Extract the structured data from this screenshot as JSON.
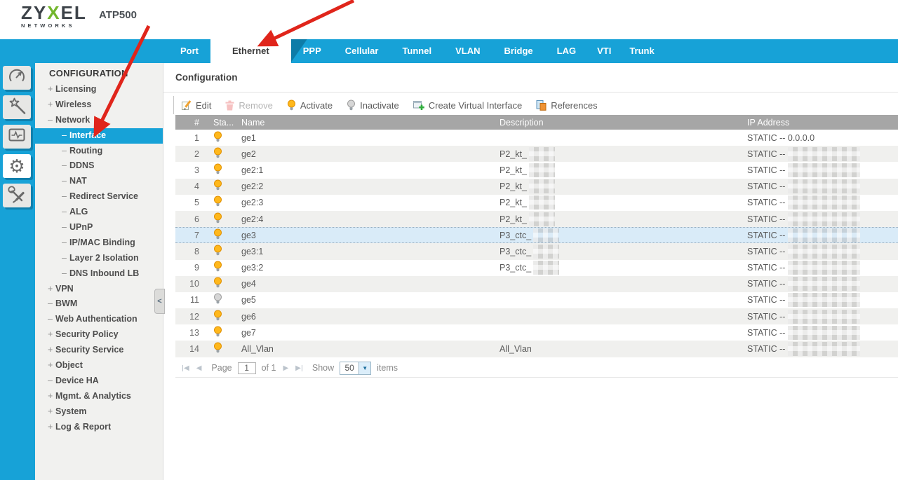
{
  "brand": {
    "logo_word": "ZYXEL",
    "logo_sub": "NETWORKS",
    "model": "ATP500"
  },
  "colors": {
    "accent_blue": "#17a2d7",
    "accent_dark_blue": "#0d7ca8",
    "bulb_on": "#ffb81c",
    "bulb_off": "#d6d6d6",
    "arrow_red": "#e0251b",
    "selected_row": "#d9ebf8",
    "table_header": "#a6a6a6"
  },
  "tabs": [
    {
      "label": "Port",
      "active": false
    },
    {
      "label": "Ethernet",
      "active": true
    },
    {
      "label": "PPP",
      "active": false
    },
    {
      "label": "Cellular",
      "active": false
    },
    {
      "label": "Tunnel",
      "active": false
    },
    {
      "label": "VLAN",
      "active": false
    },
    {
      "label": "Bridge",
      "active": false
    },
    {
      "label": "LAG",
      "active": false
    },
    {
      "label": "VTI",
      "active": false,
      "narrow": true
    },
    {
      "label": "Trunk",
      "active": false,
      "narrow": true
    }
  ],
  "rail": {
    "icons": [
      "gauge-icon",
      "wand-icon",
      "monitor-icon",
      "gear-icon",
      "tools-icon"
    ],
    "active_index": 3
  },
  "sidebar": {
    "heading": "CONFIGURATION",
    "collapse_glyph": "<",
    "items": [
      {
        "sign": "+",
        "label": "Licensing",
        "level": 1,
        "selected": false
      },
      {
        "sign": "+",
        "label": "Wireless",
        "level": 1,
        "selected": false
      },
      {
        "sign": "–",
        "label": "Network",
        "level": 1,
        "selected": false
      },
      {
        "sign": "–",
        "label": "Interface",
        "level": 2,
        "selected": true
      },
      {
        "sign": "–",
        "label": "Routing",
        "level": 2,
        "selected": false
      },
      {
        "sign": "–",
        "label": "DDNS",
        "level": 2,
        "selected": false
      },
      {
        "sign": "–",
        "label": "NAT",
        "level": 2,
        "selected": false
      },
      {
        "sign": "–",
        "label": "Redirect Service",
        "level": 2,
        "selected": false
      },
      {
        "sign": "–",
        "label": "ALG",
        "level": 2,
        "selected": false
      },
      {
        "sign": "–",
        "label": "UPnP",
        "level": 2,
        "selected": false
      },
      {
        "sign": "–",
        "label": "IP/MAC Binding",
        "level": 2,
        "selected": false
      },
      {
        "sign": "–",
        "label": "Layer 2 Isolation",
        "level": 2,
        "selected": false
      },
      {
        "sign": "–",
        "label": "DNS Inbound LB",
        "level": 2,
        "selected": false
      },
      {
        "sign": "+",
        "label": "VPN",
        "level": 1,
        "selected": false
      },
      {
        "sign": "–",
        "label": "BWM",
        "level": 1,
        "selected": false
      },
      {
        "sign": "–",
        "label": "Web Authentication",
        "level": 1,
        "selected": false
      },
      {
        "sign": "+",
        "label": "Security Policy",
        "level": 1,
        "selected": false
      },
      {
        "sign": "+",
        "label": "Security Service",
        "level": 1,
        "selected": false
      },
      {
        "sign": "+",
        "label": "Object",
        "level": 1,
        "selected": false
      },
      {
        "sign": "–",
        "label": "Device HA",
        "level": 1,
        "selected": false
      },
      {
        "sign": "+",
        "label": "Mgmt. & Analytics",
        "level": 1,
        "selected": false
      },
      {
        "sign": "+",
        "label": "System",
        "level": 1,
        "selected": false
      },
      {
        "sign": "+",
        "label": "Log & Report",
        "level": 1,
        "selected": false
      }
    ]
  },
  "main": {
    "section_title": "Configuration",
    "toolbar": [
      {
        "label": "Edit",
        "icon": "edit-icon",
        "enabled": true
      },
      {
        "label": "Remove",
        "icon": "trash-icon",
        "enabled": false
      },
      {
        "label": "Activate",
        "icon": "bulb-on-icon",
        "enabled": true
      },
      {
        "label": "Inactivate",
        "icon": "bulb-off-icon",
        "enabled": true
      },
      {
        "label": "Create Virtual Interface",
        "icon": "create-virtual-interface-icon",
        "enabled": true
      },
      {
        "label": "References",
        "icon": "references-icon",
        "enabled": true
      }
    ],
    "table": {
      "columns": [
        "#",
        "Sta...",
        "Name",
        "Description",
        "IP Address"
      ],
      "rows": [
        {
          "num": "1",
          "status": "on",
          "name": "ge1",
          "description": "",
          "description_redacted": false,
          "ip": "STATIC -- 0.0.0.0",
          "ip_redacted": false,
          "selected": false
        },
        {
          "num": "2",
          "status": "on",
          "name": "ge2",
          "description": "P2_kt_",
          "description_redacted": true,
          "ip": "STATIC --",
          "ip_redacted": true,
          "selected": false
        },
        {
          "num": "3",
          "status": "on",
          "name": "ge2:1",
          "description": "P2_kt_",
          "description_redacted": true,
          "ip": "STATIC --",
          "ip_redacted": true,
          "selected": false
        },
        {
          "num": "4",
          "status": "on",
          "name": "ge2:2",
          "description": "P2_kt_",
          "description_redacted": true,
          "ip": "STATIC --",
          "ip_redacted": true,
          "selected": false
        },
        {
          "num": "5",
          "status": "on",
          "name": "ge2:3",
          "description": "P2_kt_",
          "description_redacted": true,
          "ip": "STATIC --",
          "ip_redacted": true,
          "selected": false
        },
        {
          "num": "6",
          "status": "on",
          "name": "ge2:4",
          "description": "P2_kt_",
          "description_redacted": true,
          "ip": "STATIC --",
          "ip_redacted": true,
          "selected": false
        },
        {
          "num": "7",
          "status": "on",
          "name": "ge3",
          "description": "P3_ctc_",
          "description_redacted": true,
          "ip": "STATIC --",
          "ip_redacted": true,
          "selected": true
        },
        {
          "num": "8",
          "status": "on",
          "name": "ge3:1",
          "description": "P3_ctc_",
          "description_redacted": true,
          "ip": "STATIC --",
          "ip_redacted": true,
          "selected": false
        },
        {
          "num": "9",
          "status": "on",
          "name": "ge3:2",
          "description": "P3_ctc_",
          "description_redacted": true,
          "ip": "STATIC --",
          "ip_redacted": true,
          "selected": false
        },
        {
          "num": "10",
          "status": "on",
          "name": "ge4",
          "description": "",
          "description_redacted": false,
          "ip": "STATIC --",
          "ip_redacted": true,
          "selected": false
        },
        {
          "num": "11",
          "status": "off",
          "name": "ge5",
          "description": "",
          "description_redacted": false,
          "ip": "STATIC --",
          "ip_redacted": true,
          "selected": false
        },
        {
          "num": "12",
          "status": "on",
          "name": "ge6",
          "description": "",
          "description_redacted": false,
          "ip": "STATIC --",
          "ip_redacted": true,
          "selected": false
        },
        {
          "num": "13",
          "status": "on",
          "name": "ge7",
          "description": "",
          "description_redacted": false,
          "ip": "STATIC --",
          "ip_redacted": true,
          "selected": false
        },
        {
          "num": "14",
          "status": "on",
          "name": "All_Vlan",
          "description": "All_Vlan",
          "description_redacted": false,
          "ip": "STATIC --",
          "ip_redacted": true,
          "selected": false
        }
      ]
    },
    "pagination": {
      "page_label": "Page",
      "page_value": "1",
      "of_label": "of 1",
      "show_label": "Show",
      "show_value": "50",
      "items_label": "items"
    }
  }
}
